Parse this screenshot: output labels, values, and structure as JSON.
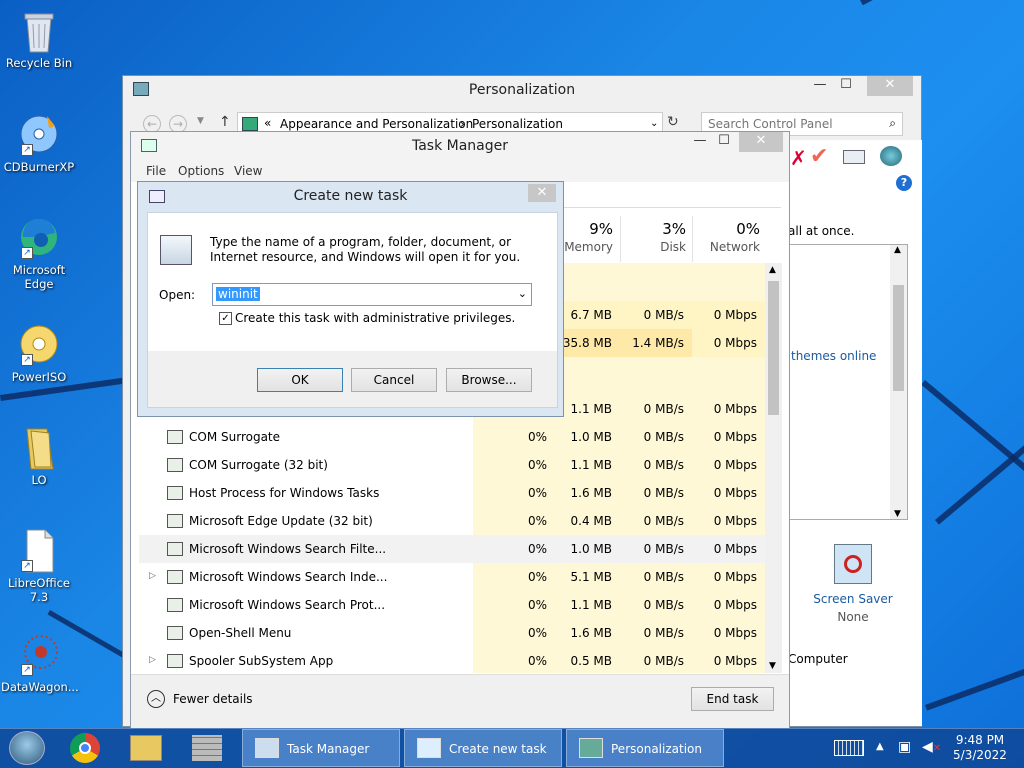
{
  "desktop": {
    "icons": [
      {
        "label": "Recycle Bin"
      },
      {
        "label": "CDBurnerXP"
      },
      {
        "label": "Microsoft Edge"
      },
      {
        "label": "PowerISO"
      },
      {
        "label": "LO"
      },
      {
        "label": "LibreOffice 7.3"
      },
      {
        "label": "DataWagon..."
      }
    ]
  },
  "personalization": {
    "title": "Personalization",
    "breadcrumb": [
      "Appearance and Personalization",
      "Personalization"
    ],
    "breadcrumb_prefix": "«",
    "search_placeholder": "Search Control Panel",
    "snippet_all_at_once": "all at once.",
    "themes_online": "themes online",
    "screen_saver_label": "Screen Saver",
    "screen_saver_value": "None",
    "computer_label": "Computer"
  },
  "task_manager": {
    "title": "Task Manager",
    "menu": [
      "File",
      "Options",
      "View"
    ],
    "columns": [
      {
        "pct": "9%",
        "label": "Memory"
      },
      {
        "pct": "3%",
        "label": "Disk"
      },
      {
        "pct": "0%",
        "label": "Network"
      }
    ],
    "partial_rows": [
      {
        "mem": "6.7 MB",
        "disk": "0 MB/s",
        "net": "0 Mbps"
      },
      {
        "mem": "35.8 MB",
        "disk": "1.4 MB/s",
        "net": "0 Mbps"
      },
      {
        "mem": "1.1 MB",
        "disk": "0 MB/s",
        "net": "0 Mbps"
      }
    ],
    "processes": [
      {
        "name": "COM Surrogate",
        "cpu": "0%",
        "mem": "1.0 MB",
        "disk": "0 MB/s",
        "net": "0 Mbps",
        "expand": false
      },
      {
        "name": "COM Surrogate (32 bit)",
        "cpu": "0%",
        "mem": "1.1 MB",
        "disk": "0 MB/s",
        "net": "0 Mbps",
        "expand": false
      },
      {
        "name": "Host Process for Windows Tasks",
        "cpu": "0%",
        "mem": "1.6 MB",
        "disk": "0 MB/s",
        "net": "0 Mbps",
        "expand": false
      },
      {
        "name": "Microsoft Edge Update (32 bit)",
        "cpu": "0%",
        "mem": "0.4 MB",
        "disk": "0 MB/s",
        "net": "0 Mbps",
        "expand": false
      },
      {
        "name": "Microsoft Windows Search Filte...",
        "cpu": "0%",
        "mem": "1.0 MB",
        "disk": "0 MB/s",
        "net": "0 Mbps",
        "expand": false
      },
      {
        "name": "Microsoft Windows Search Inde...",
        "cpu": "0%",
        "mem": "5.1 MB",
        "disk": "0 MB/s",
        "net": "0 Mbps",
        "expand": true
      },
      {
        "name": "Microsoft Windows Search Prot...",
        "cpu": "0%",
        "mem": "1.1 MB",
        "disk": "0 MB/s",
        "net": "0 Mbps",
        "expand": false
      },
      {
        "name": "Open-Shell Menu",
        "cpu": "0%",
        "mem": "1.6 MB",
        "disk": "0 MB/s",
        "net": "0 Mbps",
        "expand": false
      },
      {
        "name": "Spooler SubSystem App",
        "cpu": "0%",
        "mem": "0.5 MB",
        "disk": "0 MB/s",
        "net": "0 Mbps",
        "expand": true
      }
    ],
    "fewer_details": "Fewer details",
    "end_task": "End task"
  },
  "create_task": {
    "title": "Create new task",
    "description": "Type the name of a program, folder, document, or Internet resource, and Windows will open it for you.",
    "open_label": "Open:",
    "open_value": "wininit",
    "admin_checkbox_label": "Create this task with administrative privileges.",
    "admin_checked": true,
    "ok": "OK",
    "cancel": "Cancel",
    "browse": "Browse..."
  },
  "taskbar": {
    "buttons": [
      "Task Manager",
      "Create new task",
      "Personalization"
    ],
    "time": "9:48 PM",
    "date": "5/3/2022"
  }
}
